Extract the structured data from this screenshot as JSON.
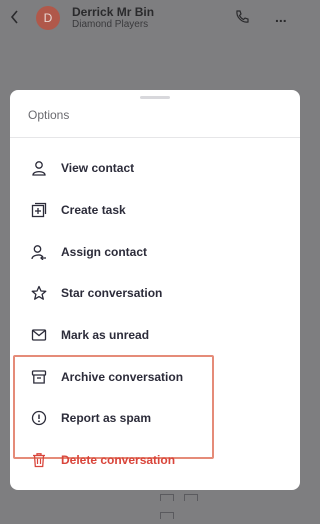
{
  "header": {
    "avatar_initial": "D",
    "contact_name": "Derrick Mr Bin",
    "contact_subtitle": "Diamond Players",
    "back_icon": "chevron-left-icon",
    "phone_icon": "phone-icon",
    "more_icon": "more-horizontal-icon",
    "more_label": "...",
    "avatar_color": "#b0584a"
  },
  "sheet": {
    "title": "Options",
    "items": [
      {
        "label": "View contact",
        "icon": "person-icon"
      },
      {
        "label": "Create task",
        "icon": "add-task-icon"
      },
      {
        "label": "Assign contact",
        "icon": "assign-person-icon"
      },
      {
        "label": "Star conversation",
        "icon": "star-icon"
      },
      {
        "label": "Mark as unread",
        "icon": "envelope-icon"
      },
      {
        "label": "Archive conversation",
        "icon": "archive-icon"
      },
      {
        "label": "Report as spam",
        "icon": "alert-circle-icon"
      },
      {
        "label": "Delete conversation",
        "icon": "trash-icon",
        "danger": true
      }
    ],
    "highlight_color": "#e58b78",
    "danger_color": "#d9453b"
  }
}
